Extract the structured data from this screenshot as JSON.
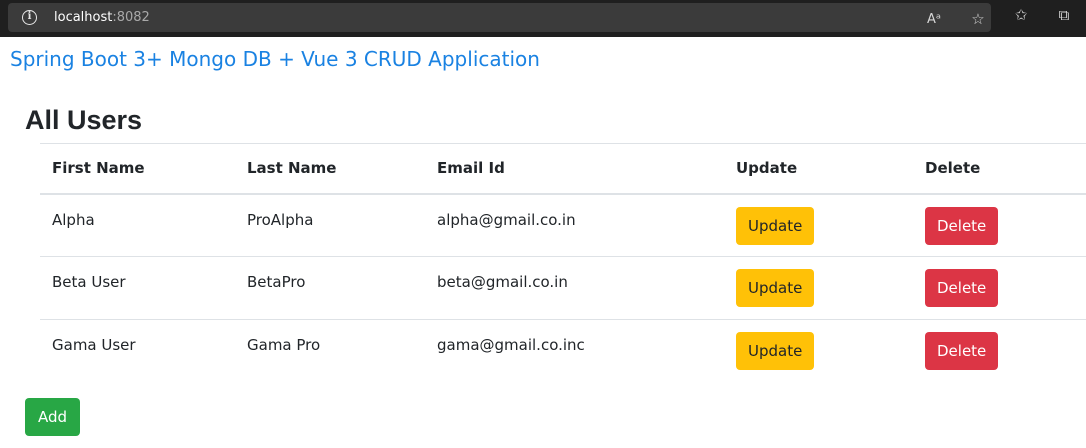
{
  "browser": {
    "url_host": "localhost",
    "url_port": ":8082",
    "icons": [
      "info-icon",
      "read-aloud-icon",
      "favorite-add-icon",
      "favorites-icon",
      "collections-icon"
    ]
  },
  "app": {
    "title": "Spring Boot 3+ Mongo DB + Vue 3 CRUD Application"
  },
  "page": {
    "heading": "All Users"
  },
  "table": {
    "headers": [
      "First Name",
      "Last Name",
      "Email Id",
      "Update",
      "Delete"
    ],
    "rows": [
      {
        "first": "Alpha",
        "last": "ProAlpha",
        "email": "alpha@gmail.co.in",
        "update": "Update",
        "delete": "Delete"
      },
      {
        "first": "Beta User",
        "last": "BetaPro",
        "email": "beta@gmail.co.in",
        "update": "Update",
        "delete": "Delete"
      },
      {
        "first": "Gama User",
        "last": "Gama Pro",
        "email": "gama@gmail.co.inc",
        "update": "Update",
        "delete": "Delete"
      }
    ]
  },
  "actions": {
    "add_label": "Add"
  },
  "colors": {
    "title_blue": "#1a82e2",
    "update_yellow": "#ffc107",
    "delete_red": "#dc3545",
    "add_green": "#28a745"
  }
}
